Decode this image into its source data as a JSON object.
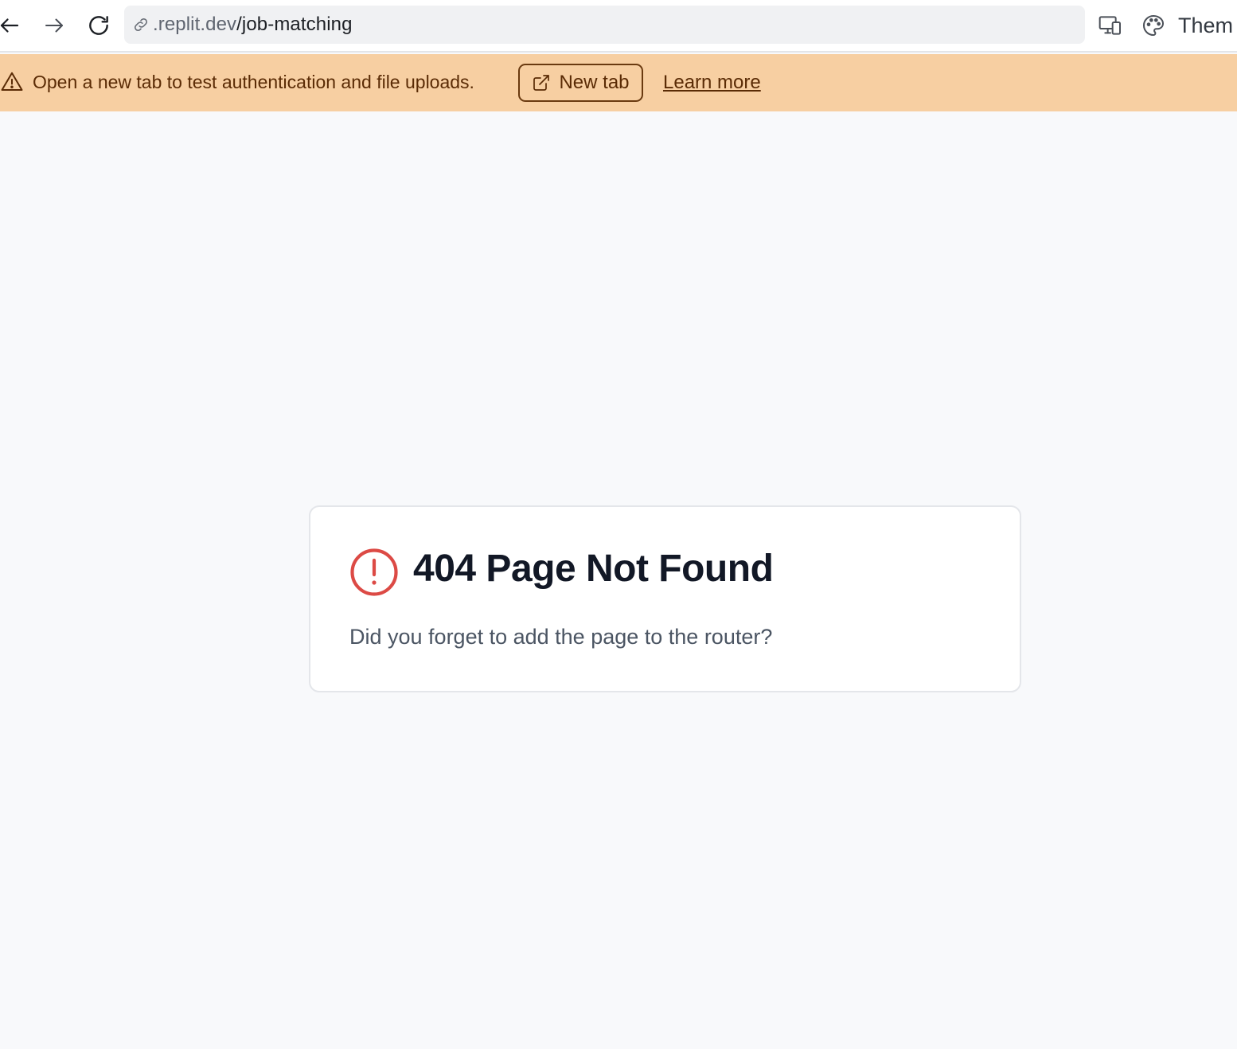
{
  "browser": {
    "url_host": ".replit.dev",
    "url_path": "/job-matching",
    "theme_label": "Them"
  },
  "banner": {
    "message": "Open a new tab to test authentication and file uploads.",
    "new_tab_label": "New tab",
    "learn_more_label": "Learn more",
    "background_color": "#f7cfa2",
    "text_color": "#5a2b05"
  },
  "not_found": {
    "title": "404 Page Not Found",
    "description": "Did you forget to add the page to the router?",
    "icon_color": "#dc4a45"
  },
  "icons": {
    "back": "arrow-left-icon",
    "forward": "arrow-right-icon",
    "reload": "reload-icon",
    "link": "link-icon",
    "device": "responsive-devices-icon",
    "theme": "palette-icon",
    "warning": "warning-triangle-icon",
    "external": "external-link-icon",
    "alert": "alert-circle-icon"
  }
}
